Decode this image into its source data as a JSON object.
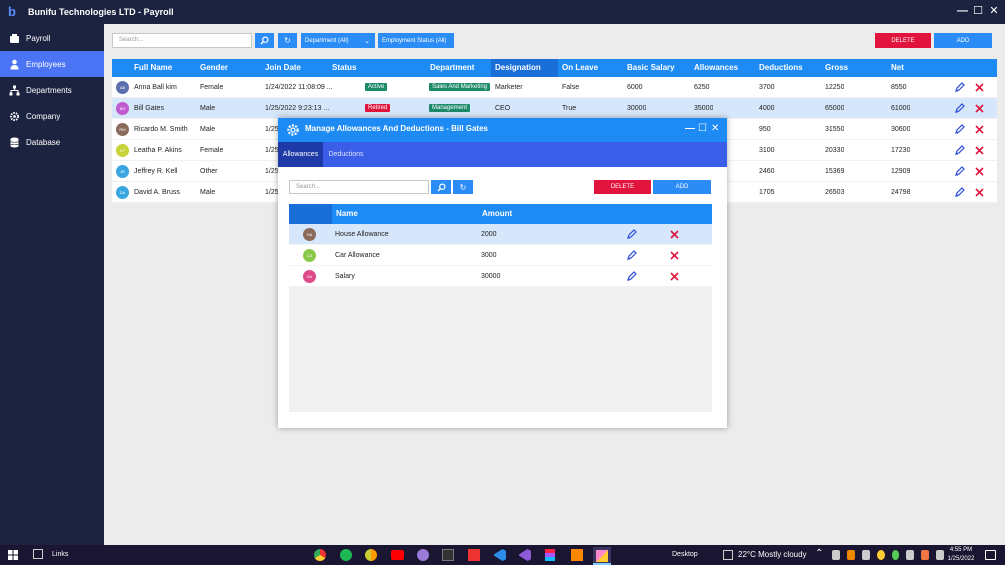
{
  "app": {
    "title": "Bunifu Technologies LTD - Payroll",
    "window_controls": [
      "—",
      "☐",
      "✕"
    ]
  },
  "sidebar": {
    "items": [
      {
        "label": "Payroll",
        "icon": "wallet-icon",
        "active": false
      },
      {
        "label": "Employees",
        "icon": "person-icon",
        "active": true
      },
      {
        "label": "Departments",
        "icon": "org-chart-icon",
        "active": false
      },
      {
        "label": "Company",
        "icon": "gear-icon",
        "active": false
      },
      {
        "label": "Database",
        "icon": "database-icon",
        "active": false
      }
    ]
  },
  "toolbar": {
    "search_placeholder": "Search...",
    "department_filter": "Department (All)",
    "status_filter": "Employment Status (All)",
    "delete_label": "DELETE",
    "add_label": "ADD"
  },
  "grid": {
    "columns": [
      "Full Name",
      "Gender",
      "Join Date",
      "Status",
      "Department",
      "Designation",
      "On Leave",
      "Basic Salary",
      "Allowances",
      "Deductions",
      "Gross",
      "Net"
    ],
    "rows": [
      {
        "initials": "AB",
        "avatar_color": "#5a6fb0",
        "name": "Anna Ball kim",
        "gender": "Female",
        "join": "1/24/2022 11:08:09 ...",
        "status": "Active",
        "status_color": "#1d8a6a",
        "dept": "Sales And Marketing",
        "designation": "Marketer",
        "on_leave": "False",
        "basic": "6000",
        "allow": "6250",
        "deduct": "3700",
        "gross": "12250",
        "net": "8550"
      },
      {
        "initials": "BG",
        "avatar_color": "#c05bd0",
        "name": "Bill Gates",
        "gender": "Male",
        "join": "1/25/2022 9:23:13 ...",
        "status": "Retired",
        "status_color": "#e0143c",
        "dept": "Management",
        "designation": "CEO",
        "on_leave": "True",
        "basic": "30000",
        "allow": "35000",
        "deduct": "4000",
        "gross": "65000",
        "net": "61000"
      },
      {
        "initials": "RM",
        "avatar_color": "#8a6a5a",
        "name": "Ricardo M. Smith",
        "gender": "Male",
        "join": "1/25",
        "status": "",
        "status_color": "",
        "dept": "",
        "designation": "",
        "on_leave": "",
        "basic": "",
        "allow": "",
        "deduct": "950",
        "gross": "31550",
        "net": "30600"
      },
      {
        "initials": "LP",
        "avatar_color": "#c8d43a",
        "name": "Leatha P. Akins",
        "gender": "Female",
        "join": "1/25",
        "status": "",
        "status_color": "",
        "dept": "",
        "designation": "",
        "on_leave": "",
        "basic": "",
        "allow": "",
        "deduct": "3100",
        "gross": "20330",
        "net": "17230"
      },
      {
        "initials": "JR",
        "avatar_color": "#3aa6e0",
        "name": "Jeffrey R. Kell",
        "gender": "Other",
        "join": "1/25",
        "status": "",
        "status_color": "",
        "dept": "",
        "designation": "",
        "on_leave": "",
        "basic": "",
        "allow": "",
        "deduct": "2460",
        "gross": "15369",
        "net": "12909"
      },
      {
        "initials": "DA",
        "avatar_color": "#3aa6e0",
        "name": "David A. Bruss",
        "gender": "Male",
        "join": "1/25",
        "status": "",
        "status_color": "",
        "dept": "",
        "designation": "",
        "on_leave": "",
        "basic": "",
        "allow": "",
        "deduct": "1705",
        "gross": "26503",
        "net": "24798"
      }
    ]
  },
  "dialog": {
    "title": "Manage Allowances And Deductions - Bill Gates",
    "tabs": [
      "Allowances",
      "Deductions"
    ],
    "search_placeholder": "Search...",
    "delete_label": "DELETE",
    "add_label": "ADD",
    "columns": [
      "Name",
      "Amount"
    ],
    "rows": [
      {
        "initials": "HA",
        "avatar_color": "#8a6a5a",
        "name": "House Allowance",
        "amount": "2000"
      },
      {
        "initials": "CA",
        "avatar_color": "#8ac84a",
        "name": "Car Allowance",
        "amount": "3000"
      },
      {
        "initials": "SA",
        "avatar_color": "#e04a8a",
        "name": "Salary",
        "amount": "30000"
      }
    ]
  },
  "taskbar": {
    "links_label": "Links",
    "desktop_label": "Desktop",
    "weather": "22°C  Mostly cloudy",
    "time": "4:55 PM",
    "date": "1/25/2022"
  },
  "colors": {
    "accent": "#1e8bf5",
    "danger": "#e0143c",
    "sidebar": "#1c2340",
    "active_nav": "#4a74f4"
  }
}
